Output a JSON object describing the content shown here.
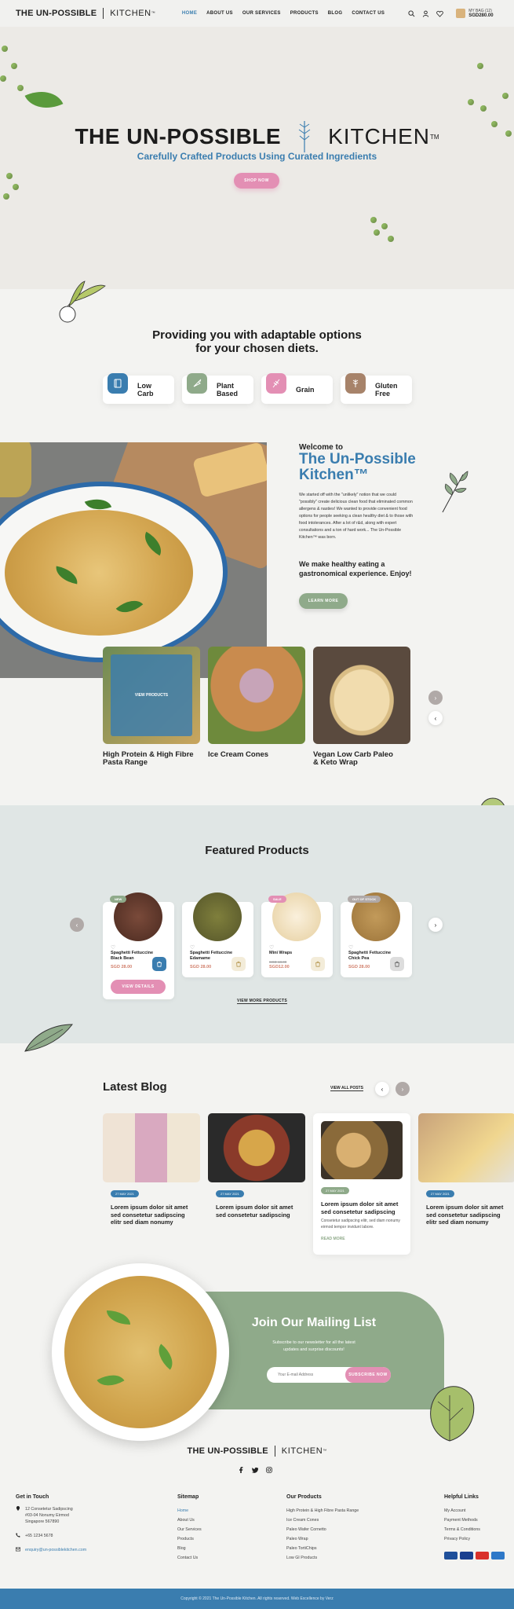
{
  "header": {
    "logo_a": "THE UN-POSSIBLE",
    "logo_b": "KITCHEN",
    "nav": [
      "HOME",
      "ABOUT US",
      "OUR SERVICES",
      "PRODUCTS",
      "BLOG",
      "CONTACT US"
    ],
    "cart_label": "MY BAG (12)",
    "cart_total": "SGD280.00"
  },
  "hero": {
    "title_a": "THE UN-POSSIBLE",
    "title_b": "KITCHEN",
    "tm": "TM",
    "subtitle": "Carefully Crafted Products Using Curated Ingredients",
    "cta": "SHOP NOW"
  },
  "diets": {
    "title_line1": "Providing you with adaptable options",
    "title_line2": "for your chosen diets.",
    "items": [
      {
        "label1": "Low",
        "label2": "Carb",
        "color": "#3a7daf"
      },
      {
        "label1": "Plant",
        "label2": "Based",
        "color": "#8faa8a"
      },
      {
        "label1": "Grain",
        "label2": "",
        "color": "#e38fb4"
      },
      {
        "label1": "Gluten",
        "label2": "Free",
        "color": "#a7836a"
      }
    ]
  },
  "welcome": {
    "kicker": "Welcome to",
    "title_line1": "The Un-Possible",
    "title_line2": "Kitchen™",
    "body": "We started off with the \"unlikely\" notion that we could \"possibly\" create delicious clean food that eliminated common allergens & nasties! We wanted to provide convenient food options for people seeking a clean healthy diet & to those with food intolerances. After a lot of r&d, along with expert consultations and a ton of hard work... The Un-Possible Kitchen™ was born.",
    "tagline": "We make healthy eating a gastronomical experience. Enjoy!",
    "cta": "LEARN MORE"
  },
  "categories": [
    {
      "name_line1": "High Protein & High Fibre",
      "name_line2": "Pasta Range",
      "overlay": "VIEW PRODUCTS"
    },
    {
      "name_line1": "Ice Cream Cones",
      "name_line2": ""
    },
    {
      "name_line1": "Vegan Low Carb Paleo",
      "name_line2": "& Keto Wrap"
    }
  ],
  "featured": {
    "title": "Featured Products",
    "view_all": "VIEW MORE PRODUCTS",
    "products": [
      {
        "badge": "NEW",
        "badge_color": "#8faa8a",
        "name_line1": "Spaghetti Fettuccine",
        "name_line2": "Black Bean",
        "old_price": "",
        "price": "SGD 28.00",
        "details": "VIEW DETAILS"
      },
      {
        "badge": "",
        "badge_color": "",
        "name_line1": "Spaghetti Fettuccine",
        "name_line2": "Edamame",
        "old_price": "",
        "price": "SGD 28.00"
      },
      {
        "badge": "SALE",
        "badge_color": "#e38fb4",
        "name_line1": "Mini Wraps",
        "name_line2": "",
        "old_price": "SGD 18.00",
        "price": "SGD12.00"
      },
      {
        "badge": "OUT OF STOCK",
        "badge_color": "#b0a9a7",
        "name_line1": "Spaghetti Fettuccine",
        "name_line2": "Chick Pea",
        "old_price": "",
        "price": "SGD 28.00"
      }
    ]
  },
  "blog": {
    "title": "Latest Blog",
    "view_all": "VIEW ALL POSTS",
    "posts": [
      {
        "date": "27 MAY 2021",
        "title": "Lorem ipsum dolor sit amet sed consetetur sadipscing elitr sed diam nonumy"
      },
      {
        "date": "27 MAY 2021",
        "title": "Lorem ipsum dolor sit amet sed consetetur sadipscing"
      },
      {
        "date": "27 MAY 2021",
        "title": "Lorem ipsum dolor sit amet sed consetetur sadipscing",
        "excerpt": "Consetetur sadipscing elitr, sed diam nonumy eirmod tempor invidunt labore.",
        "read_more": "READ MORE"
      },
      {
        "date": "27 MAY 2021",
        "title": "Lorem ipsum dolor sit amet sed consetetur sadipscing elitr sed diam nonumy"
      }
    ]
  },
  "mailing": {
    "title": "Join Our Mailing List",
    "subtitle": "Subscribe to our newsletter for all the latest updates and surprise discounts!",
    "placeholder": "Your E-mail Address",
    "cta": "SUBSCRIBE NOW"
  },
  "footer": {
    "logo_a": "THE UN-POSSIBLE",
    "logo_b": "KITCHEN",
    "get_in_touch": {
      "title": "Get in Touch",
      "address": [
        "12 Consetetur Sadipscing",
        "#03-04 Nonumy Eirmod",
        "Singapore 567890"
      ],
      "phone": "+65 1234 5678",
      "email": "enquiry@un-possiblekitchen.com"
    },
    "sitemap": {
      "title": "Sitemap",
      "items": [
        "Home",
        "About Us",
        "Our Services",
        "Products",
        "Blog",
        "Contact Us"
      ]
    },
    "products": {
      "title": "Our Products",
      "items": [
        "High Protein & High Fibre Pasta Range",
        "Ice Cream Cones",
        "Paleo Wafer Cornetto",
        "Paleo Wrap",
        "Paleo TortiChips",
        "Low GI Products"
      ]
    },
    "helpful": {
      "title": "Helpful Links",
      "items": [
        "My Account",
        "Payment Methods",
        "Terms & Conditions",
        "Privacy Policy"
      ]
    },
    "copyright": "Copyright © 2021 The Un-Possible Kitchen. All rights reserved. Web Excellence by Verz"
  },
  "colors": {
    "accent_blue": "#3a7daf",
    "accent_pink": "#e38fb4",
    "accent_green": "#8faa8a"
  }
}
